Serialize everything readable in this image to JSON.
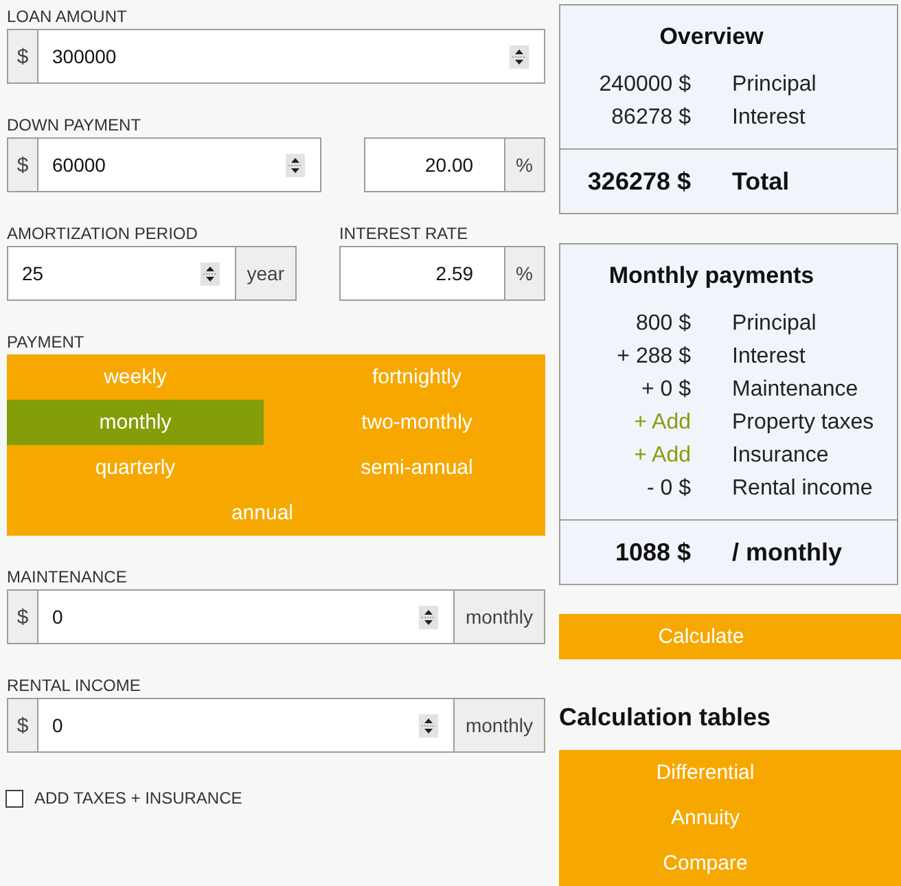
{
  "form": [
    {
      "kind": "fields",
      "fields": [
        {
          "label": "LOAN AMOUNT",
          "inputs": [
            {
              "kind": "spin",
              "prefix": "$",
              "value": "300000"
            }
          ]
        }
      ]
    },
    {
      "kind": "fields",
      "fields": [
        {
          "label": "DOWN PAYMENT",
          "inputs": [
            {
              "kind": "spin",
              "prefix": "$",
              "value": "60000"
            },
            {
              "kind": "decimal",
              "value": "20.00",
              "suffix": "%"
            }
          ]
        }
      ]
    },
    {
      "kind": "fields",
      "fields": [
        {
          "label": "AMORTIZATION PERIOD",
          "inputs": [
            {
              "kind": "spin",
              "value": "25",
              "suffix": "year"
            }
          ]
        },
        {
          "label": "INTEREST RATE",
          "inputs": [
            {
              "kind": "decimal",
              "value": "2.59",
              "suffix": "%"
            }
          ]
        }
      ]
    },
    {
      "kind": "choice",
      "label": "PAYMENT",
      "options": [
        {
          "label": "weekly",
          "selected": false
        },
        {
          "label": "fortnightly",
          "selected": false
        },
        {
          "label": "monthly",
          "selected": true
        },
        {
          "label": "two-monthly",
          "selected": false
        },
        {
          "label": "quarterly",
          "selected": false
        },
        {
          "label": "semi-annual",
          "selected": false
        },
        {
          "label": "annual",
          "selected": false
        }
      ]
    },
    {
      "kind": "fields",
      "fields": [
        {
          "label": "MAINTENANCE",
          "inputs": [
            {
              "kind": "spin",
              "prefix": "$",
              "value": "0",
              "suffix": "monthly"
            }
          ]
        }
      ]
    },
    {
      "kind": "fields",
      "fields": [
        {
          "label": "RENTAL INCOME",
          "inputs": [
            {
              "kind": "spin",
              "prefix": "$",
              "value": "0",
              "suffix": "monthly"
            }
          ]
        }
      ]
    },
    {
      "kind": "checkbox",
      "label": "ADD TAXES + INSURANCE",
      "checked": false
    }
  ],
  "overview": {
    "title": "Overview",
    "rows": [
      {
        "amount": "240000 $",
        "label": "Principal"
      },
      {
        "amount": "86278 $",
        "label": "Interest"
      }
    ],
    "total": {
      "amount": "326278 $",
      "label": "Total"
    }
  },
  "monthly_payments": {
    "title": "Monthly payments",
    "rows": [
      {
        "kind": "amount",
        "amount": "800 $",
        "label": "Principal"
      },
      {
        "kind": "amount",
        "amount": "+ 288 $",
        "label": "Interest"
      },
      {
        "kind": "amount",
        "amount": "+ 0 $",
        "label": "Maintenance"
      },
      {
        "kind": "add_link",
        "amount": "+ Add",
        "label": "Property taxes"
      },
      {
        "kind": "add_link",
        "amount": "+ Add",
        "label": "Insurance"
      },
      {
        "kind": "amount",
        "amount": "- 0 $",
        "label": "Rental income"
      }
    ],
    "total": {
      "amount": "1088 $",
      "label": "/ monthly"
    }
  },
  "calculate_button": {
    "label": "Calculate"
  },
  "calculation_tables": {
    "title": "Calculation tables",
    "items": [
      {
        "label": "Differential"
      },
      {
        "label": "Annuity"
      },
      {
        "label": "Compare"
      }
    ]
  }
}
